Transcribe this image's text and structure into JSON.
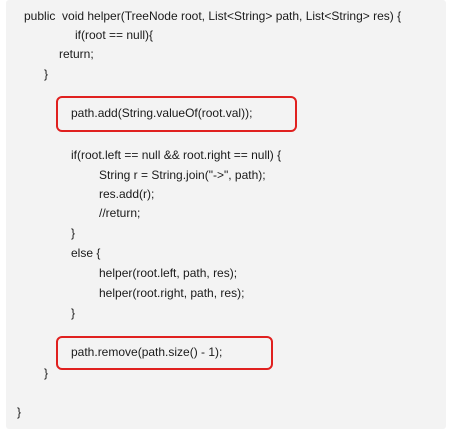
{
  "code": {
    "lines": [
      "public  void helper(TreeNode root, List<String> path, List<String> res) {",
      "if(root == null){",
      "return;",
      "}",
      "path.add(String.valueOf(root.val));",
      "if(root.left == null && root.right == null) {",
      "String r = String.join(\"->\", path);",
      "res.add(r);",
      "//return;",
      "}",
      "else {",
      "helper(root.left, path, res);",
      "helper(root.right, path, res);",
      "}",
      "path.remove(path.size() - 1);",
      "}",
      "}"
    ]
  },
  "highlights": {
    "color": "#e0201f"
  }
}
